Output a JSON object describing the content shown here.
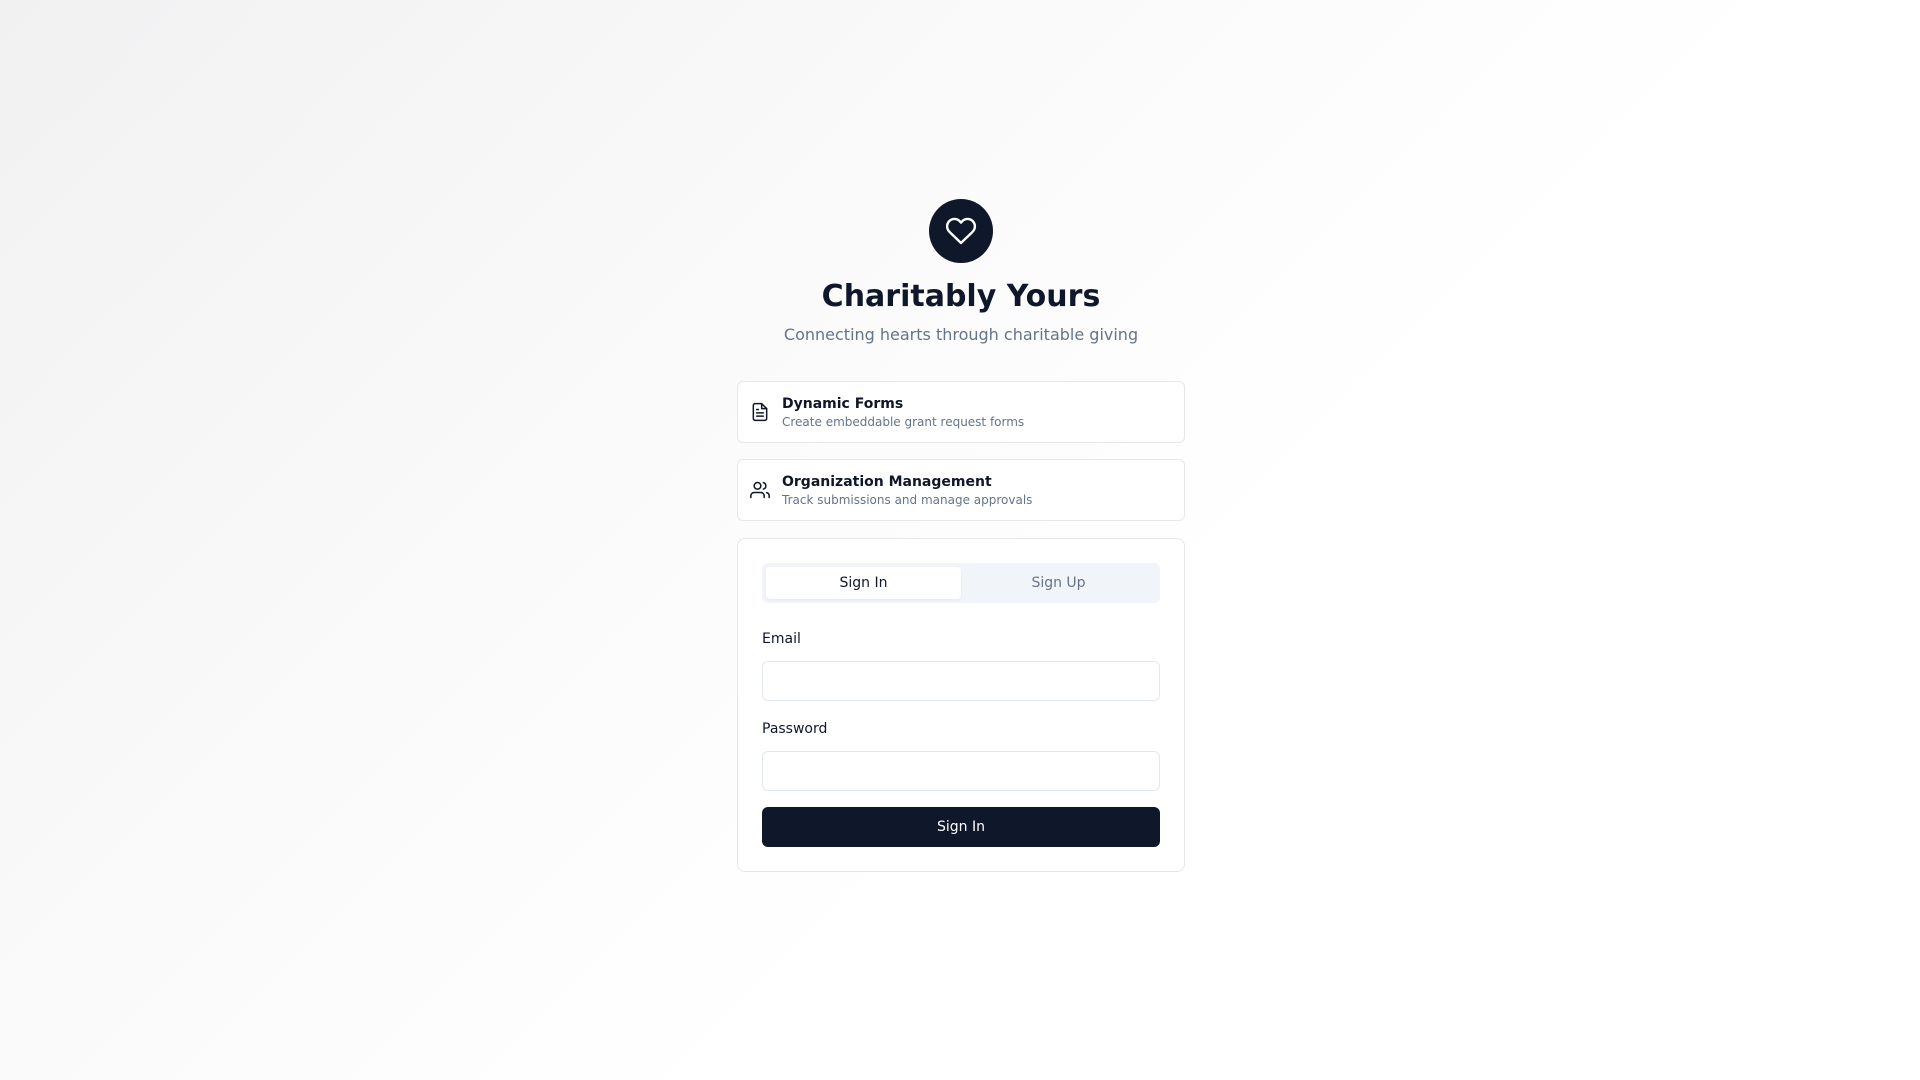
{
  "brand": {
    "logo_icon": "heart-icon",
    "title": "Charitably Yours",
    "subtitle": "Connecting hearts through charitable giving"
  },
  "features": [
    {
      "icon": "file-text-icon",
      "title": "Dynamic Forms",
      "description": "Create embeddable grant request forms"
    },
    {
      "icon": "users-icon",
      "title": "Organization Management",
      "description": "Track submissions and manage approvals"
    }
  ],
  "auth": {
    "tabs": [
      {
        "label": "Sign In",
        "active": true
      },
      {
        "label": "Sign Up",
        "active": false
      }
    ],
    "email_label": "Email",
    "email_value": "",
    "password_label": "Password",
    "password_value": "",
    "submit_label": "Sign In"
  },
  "colors": {
    "primary": "#0f172a",
    "muted_text": "#64748b",
    "border": "#e5e7eb",
    "tab_background": "#f1f5f9"
  }
}
